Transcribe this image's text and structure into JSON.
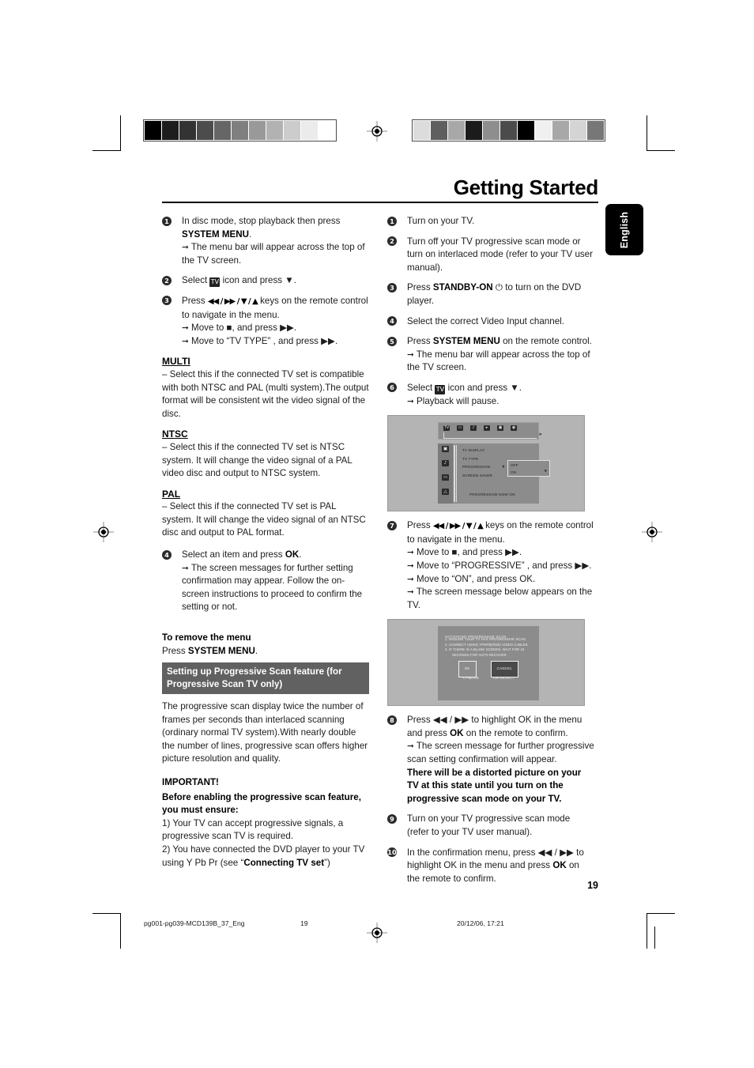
{
  "header": {
    "title": "Getting Started",
    "language_tab": "English"
  },
  "left_column": {
    "steps": [
      {
        "num": "1",
        "text_1": "In disc mode, stop playback then press ",
        "bold_1": "SYSTEM MENU",
        "text_2": ".",
        "arrows": [
          "The menu bar will appear across the top of the TV screen."
        ]
      },
      {
        "num": "2",
        "text_1": "Select ",
        "chip": "TV",
        "text_2": " icon and press ▼."
      },
      {
        "num": "3",
        "text_1": "Press ",
        "keys": "◀◀ / ▶▶  /  ▼  /  ▲",
        "text_2": " keys on the remote control to navigate in the menu.",
        "arrows": [
          "Move to ■, and press ▶▶.",
          "Move to “TV TYPE” , and press ▶▶."
        ]
      },
      {
        "num": "4",
        "text_1": "Select an item and press ",
        "bold_1": "OK",
        "text_2": ".",
        "arrows": [
          "The screen messages for further setting confirmation may appear. Follow the on-screen instructions to proceed to confirm the setting or not."
        ]
      }
    ],
    "definitions": [
      {
        "term": "MULTI",
        "body": "–   Select this if the connected TV set is compatible with both NTSC and PAL (multi system).The output format will be consistent wit the video signal of the disc."
      },
      {
        "term": "NTSC",
        "body": "–   Select this if the connected TV set is NTSC system. It will change the video signal of a PAL video disc and output to NTSC system."
      },
      {
        "term": "PAL",
        "body": "–   Select this if the connected TV set is PAL system. It will change the video signal of an NTSC disc and output to PAL format."
      }
    ],
    "remove_menu": {
      "heading": "To remove the menu",
      "text_1": "Press ",
      "bold_1": "SYSTEM MENU",
      "text_2": "."
    },
    "progressive_section": {
      "heading": "Setting up Progressive Scan feature (for Progressive Scan TV only)",
      "paragraph": "The progressive scan display twice the number of frames per seconds than interlaced scanning (ordinary normal TV system).With nearly double the number of lines, progressive scan offers higher picture resolution and quality.",
      "important_title": "IMPORTANT!",
      "important_lead": "Before enabling the progressive scan feature, you must ensure:",
      "item_1": "1) Your TV can accept progressive signals, a progressive scan TV is required.",
      "item_2_pre": "2) You have connected the DVD player to your TV using Y Pb Pr (see “",
      "item_2_bold": "Connecting TV set",
      "item_2_post": "”)"
    }
  },
  "right_column": {
    "steps": [
      {
        "num": "1",
        "text_1": "Turn on your TV."
      },
      {
        "num": "2",
        "text_1": "Turn off your TV progressive scan mode or turn on interlaced mode (refer to your TV user manual)."
      },
      {
        "num": "3",
        "text_1": "Press ",
        "bold_1": "STANDBY-ON",
        "text_2": " ⏻ to turn on the DVD player."
      },
      {
        "num": "4",
        "text_1": "Select the correct Video Input channel."
      },
      {
        "num": "5",
        "text_1": "Press ",
        "bold_1": "SYSTEM MENU",
        "text_2": " on the remote control.",
        "arrows": [
          "The menu bar will appear across the top of the TV screen."
        ]
      },
      {
        "num": "6",
        "text_1": "Select ",
        "chip": "TV",
        "text_2": " icon and press ▼.",
        "arrows": [
          "Playback will pause."
        ]
      },
      {
        "num": "7",
        "text_1": "Press ",
        "keys": "◀◀ / ▶▶  /  ▼  /  ▲",
        "text_2": " keys on the remote control to navigate in the menu.",
        "arrows": [
          "Move to ■, and press ▶▶.",
          "Move to “PROGRESSIVE” , and press ▶▶.",
          "Move to “ON”,  and press OK.",
          "The screen message below appears on the TV."
        ]
      },
      {
        "num": "8",
        "text_1": "Press ◀◀ / ▶▶  to highlight OK in the menu and press ",
        "bold_1": "OK",
        "text_2": " on the remote to confirm.",
        "arrows": [
          "The screen message for further progressive scan setting confirmation will appear."
        ],
        "bold_block": "There will be a distorted picture on your TV at this state until you turn on the progressive scan mode on your TV."
      },
      {
        "num": "9",
        "text_1": "Turn on your TV progressive scan mode (refer to your TV user manual)."
      },
      {
        "num": "10",
        "text_1": "In the confirmation menu, press ◀◀ / ▶▶  to highlight OK in the menu and press ",
        "bold_1": "OK",
        "text_2": " on the remote to confirm."
      }
    ]
  },
  "figure_setup_menu": {
    "menubar_icons": [
      "tv-icon",
      "display-icon",
      "audio-icon",
      "play-icon",
      "video-icon",
      "preference-icon"
    ],
    "sidebar_icons": [
      "tv-setup-icon",
      "audio-setup-icon",
      "language-setup-icon",
      "preference-setup-icon"
    ],
    "items": [
      "TV DISPLAY",
      "TV TYPE",
      "PROGRESSIVE",
      "SCREEN SAVER"
    ],
    "dropdown_options": [
      "OFF",
      "ON"
    ],
    "status": "PROGRESSIVE NOW ON"
  },
  "figure_progressive_dialog": {
    "title": "ACTIVATING  PROGRESSIVE SCAN",
    "line_1": "1.  ENSURE YOUR TV HAS PROGRESSIVE SCAN.",
    "line_2": "2.  CONNECT USING YPRPB(RGB) VIDEO CABLES.",
    "line_3": "3.  IF THERE IS A BLANK SCREEN, WAIT FOR 15",
    "line_4": "SECONDS FOR AUTO RECOVER.",
    "button_ok": "OK",
    "button_cancel": "CANCEL",
    "hint_move": "<>-MOVE",
    "hint_select": "OK-SELECT"
  },
  "page_number": "19",
  "footer": {
    "file": "pg001-pg039-MCD139B_37_Eng",
    "page": "19",
    "date": "20/12/06, 17:21"
  },
  "calibration": {
    "left_bar": [
      "#000000",
      "#1d1d1d",
      "#333333",
      "#4c4c4c",
      "#666666",
      "#7f7f7f",
      "#999999",
      "#b2b2b2",
      "#cccccc",
      "#ebebeb",
      "#ffffff"
    ],
    "right_bar": [
      "#dcdcdc",
      "#5f5f5f",
      "#a8a8a8",
      "#1b1b1b",
      "#8e8e8e",
      "#4b4b4b",
      "#000000",
      "#f0f0f0",
      "#a8a8a8",
      "#d4d4d4",
      "#777777"
    ]
  }
}
